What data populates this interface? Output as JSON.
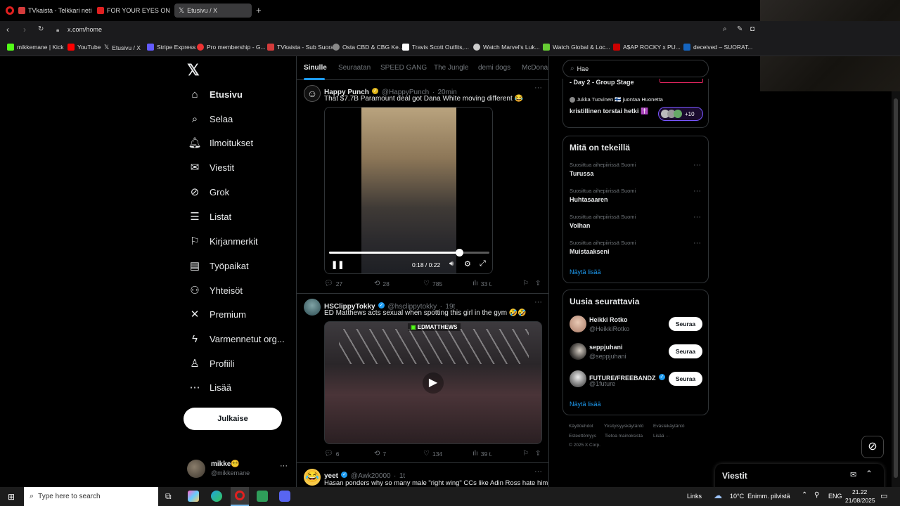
{
  "browser": {
    "tabs": [
      {
        "label": "TVkaista - Telkkari netissä",
        "color": "#d43b3b"
      },
      {
        "label": "FOR YOUR EYES ONLY | O",
        "color": "#e02020"
      },
      {
        "label": "Etusivu / X",
        "color": "#ffffff"
      }
    ],
    "url": "x.com/home",
    "bookmarks": [
      {
        "label": "mikkemane | Kick",
        "color": "#53fc18"
      },
      {
        "label": "YouTube",
        "color": "#ff0000"
      },
      {
        "label": "Etusivu / X",
        "color": "#ffffff"
      },
      {
        "label": "Stripe Express",
        "color": "#635bff"
      },
      {
        "label": "Pro membership - G...",
        "color": "#e33"
      },
      {
        "label": "TVkaista - Sub Suora",
        "color": "#d43b3b"
      },
      {
        "label": "Osta CBD & CBG Ke...",
        "color": "#888"
      },
      {
        "label": "Travis Scott Outfits,...",
        "color": "#fff"
      },
      {
        "label": "Watch Marvel's Luk...",
        "color": "#ccc"
      },
      {
        "label": "Watch Global & Loc...",
        "color": "#6c3"
      },
      {
        "label": "A$AP ROCKY x PU...",
        "color": "#c00"
      },
      {
        "label": "deceived – SUORAT...",
        "color": "#1565c0"
      }
    ]
  },
  "sidebar": {
    "logo": "𝕏",
    "items": [
      {
        "label": "Etusivu",
        "icon": "home-icon",
        "glyph": "⌂"
      },
      {
        "label": "Selaa",
        "icon": "search-icon",
        "glyph": "⌕"
      },
      {
        "label": "Ilmoitukset",
        "icon": "bell-icon",
        "glyph": "🔔︎"
      },
      {
        "label": "Viestit",
        "icon": "mail-icon",
        "glyph": "✉"
      },
      {
        "label": "Grok",
        "icon": "grok-icon",
        "glyph": "⊘"
      },
      {
        "label": "Listat",
        "icon": "list-icon",
        "glyph": "☰"
      },
      {
        "label": "Kirjanmerkit",
        "icon": "bookmark-icon",
        "glyph": "⚐"
      },
      {
        "label": "Työpaikat",
        "icon": "briefcase-icon",
        "glyph": "▤"
      },
      {
        "label": "Yhteisöt",
        "icon": "communities-icon",
        "glyph": "⚇"
      },
      {
        "label": "Premium",
        "icon": "x-premium-icon",
        "glyph": "✕"
      },
      {
        "label": "Varmennetut org...",
        "icon": "lightning-icon",
        "glyph": "ϟ"
      },
      {
        "label": "Profiili",
        "icon": "profile-icon",
        "glyph": "♙"
      },
      {
        "label": "Lisää",
        "icon": "more-icon",
        "glyph": "⋯"
      }
    ],
    "post_label": "Julkaise",
    "account": {
      "name": "mikke😵‍💫",
      "handle": "@mikkemane"
    }
  },
  "timeline": {
    "tabs": [
      "Sinulle",
      "Seuraatan",
      "SPEED GANG",
      "The Jungle",
      "demi dogs",
      "McDonal"
    ],
    "tweets": [
      {
        "name": "Happy Punch",
        "handle": "@HappyPunch",
        "time": "20min",
        "text": "That $7.7B Paramount deal got Dana White moving different 😂",
        "video_time": "0:18 / 0:22",
        "progress": 0.81,
        "replies": "27",
        "reposts": "28",
        "likes": "785",
        "views": "33 t."
      },
      {
        "name": "HSClippyTokky",
        "handle": "@hsclippytokky",
        "time": "19t",
        "text": "ED Matthews acts sexual when spotting this girl in the gym 🤣🤣",
        "watermark": "EDMATTHEWS",
        "replies": "6",
        "reposts": "7",
        "likes": "134",
        "views": "39 t."
      },
      {
        "name": "yeet",
        "handle": "@Awk20000",
        "time": "1t",
        "text": "Hasan ponders why so many male \"right wing\" CCs like Adin Ross hate him"
      }
    ]
  },
  "right": {
    "search_placeholder": "Hae",
    "top_panel": {
      "event": "- Day 2 - Group Stage",
      "space_host": "Jukka Tuovinen 🇫🇮 juontaa Huonetta",
      "space_title": "kristillinen torstai hetki ✝️",
      "listeners": "+10"
    },
    "trends": {
      "title": "Mitä on tekeillä",
      "items": [
        {
          "context": "Suosittua aihepiirissä Suomi",
          "name": "Turussa"
        },
        {
          "context": "Suosittua aihepiirissä Suomi",
          "name": "Huhtasaaren"
        },
        {
          "context": "Suosittua aihepiirissä Suomi",
          "name": "Volhan"
        },
        {
          "context": "Suosittua aihepiirissä Suomi",
          "name": "Muistaakseni"
        }
      ],
      "more": "Näytä lisää"
    },
    "who_to_follow": {
      "title": "Uusia seurattavia",
      "users": [
        {
          "name": "Heikki Rotko",
          "handle": "@HeikkiRotko",
          "verified": false
        },
        {
          "name": "seppjuhani",
          "handle": "@seppjuhani",
          "verified": false
        },
        {
          "name": "FUTURE/FREEBANDZ",
          "handle": "@1future",
          "verified": true
        }
      ],
      "follow_label": "Seuraa",
      "more": "Näytä lisää"
    },
    "footer": [
      "Käyttöehdot",
      "Yksityisyyskäytäntö",
      "Evästekäytäntö",
      "Esteettömyys",
      "Tietoa mainoksista",
      "Lisää ···",
      "© 2025 X Corp."
    ]
  },
  "messages_dock": {
    "title": "Viestit"
  },
  "taskbar": {
    "search_placeholder": "Type here to search",
    "links": "Links",
    "weather": "10°C  Enimm. pilvistä",
    "lang": "ENG",
    "time": "21.22",
    "date": "21/08/2025"
  }
}
